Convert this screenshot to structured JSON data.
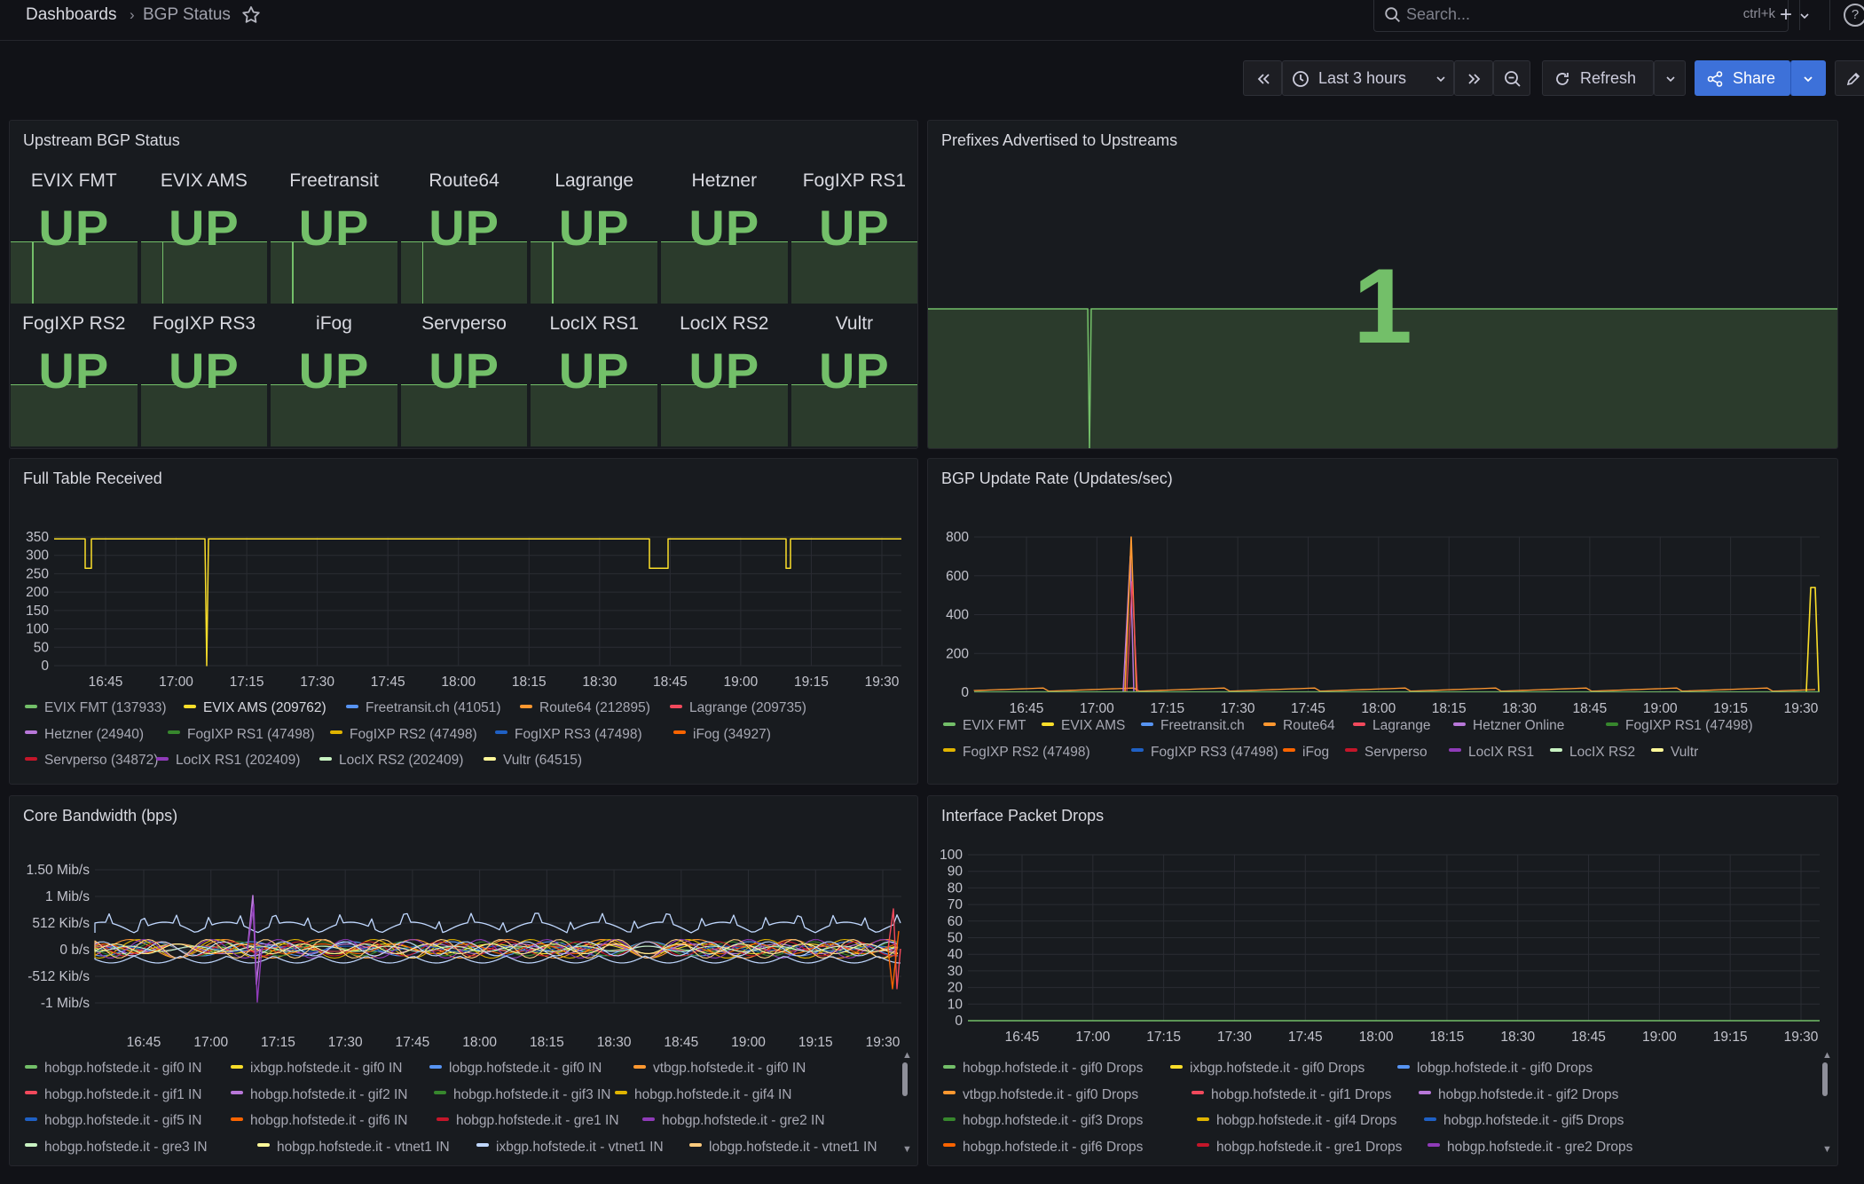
{
  "breadcrumb": {
    "root": "Dashboards",
    "separator": "›",
    "page": "BGP Status"
  },
  "search": {
    "placeholder": "Search...",
    "shortcut": "ctrl+k"
  },
  "topbar": {
    "plus": "+",
    "help": "?"
  },
  "toolbar": {
    "time_range": "Last 3 hours",
    "refresh": "Refresh",
    "share": "Share"
  },
  "colors": {
    "green": "#73bf69",
    "panel_bg": "#181b1f",
    "accent": "#3d71d9"
  },
  "icons": [
    "star-icon",
    "search-icon",
    "clock-icon",
    "zoom-out-icon",
    "refresh-icon",
    "share-icon",
    "edit-icon",
    "chevron-down-icon",
    "double-left-icon",
    "double-right-icon"
  ],
  "panels": {
    "upstream": {
      "title": "Upstream BGP Status",
      "items": [
        {
          "name": "EVIX FMT",
          "value": "UP"
        },
        {
          "name": "EVIX AMS",
          "value": "UP"
        },
        {
          "name": "Freetransit",
          "value": "UP"
        },
        {
          "name": "Route64",
          "value": "UP"
        },
        {
          "name": "Lagrange",
          "value": "UP"
        },
        {
          "name": "Hetzner",
          "value": "UP"
        },
        {
          "name": "FogIXP RS1",
          "value": "UP"
        },
        {
          "name": "FogIXP RS2",
          "value": "UP"
        },
        {
          "name": "FogIXP RS3",
          "value": "UP"
        },
        {
          "name": "iFog",
          "value": "UP"
        },
        {
          "name": "Servperso",
          "value": "UP"
        },
        {
          "name": "LocIX RS1",
          "value": "UP"
        },
        {
          "name": "LocIX RS2",
          "value": "UP"
        },
        {
          "name": "Vultr",
          "value": "UP"
        }
      ]
    },
    "prefixes": {
      "title": "Prefixes Advertised to Upstreams",
      "value": "1"
    },
    "fulltable": {
      "title": "Full Table Received",
      "legend": [
        "EVIX FMT (137933)",
        "EVIX AMS (209762)",
        "Freetransit.ch (41051)",
        "Route64 (212895)",
        "Lagrange (209735)",
        "Hetzner (24940)",
        "FogIXP RS1 (47498)",
        "FogIXP RS2 (47498)",
        "FogIXP RS3 (47498)",
        "iFog (34927)",
        "Servperso (34872)",
        "LocIX RS1 (202409)",
        "LocIX RS2 (202409)",
        "Vultr (64515)"
      ]
    },
    "updaterate": {
      "title": "BGP Update Rate (Updates/sec)",
      "legend": [
        "EVIX FMT",
        "EVIX AMS",
        "Freetransit.ch",
        "Route64",
        "Lagrange",
        "Hetzner Online",
        "FogIXP RS1 (47498)",
        "FogIXP RS2 (47498)",
        "FogIXP RS3 (47498)",
        "iFog",
        "Servperso",
        "LocIX RS1",
        "LocIX RS2",
        "Vultr"
      ]
    },
    "bandwidth": {
      "title": "Core Bandwidth (bps)",
      "legend": [
        "hobgp.hofstede.it - gif0 IN",
        "ixbgp.hofstede.it - gif0 IN",
        "lobgp.hofstede.it - gif0 IN",
        "vtbgp.hofstede.it - gif0 IN",
        "hobgp.hofstede.it - gif1 IN",
        "hobgp.hofstede.it - gif2 IN",
        "hobgp.hofstede.it - gif3 IN",
        "hobgp.hofstede.it - gif4 IN",
        "hobgp.hofstede.it - gif5 IN",
        "hobgp.hofstede.it - gif6 IN",
        "hobgp.hofstede.it - gre1 IN",
        "hobgp.hofstede.it - gre2 IN",
        "hobgp.hofstede.it - gre3 IN",
        "hobgp.hofstede.it - vtnet1 IN",
        "ixbgp.hofstede.it - vtnet1 IN",
        "lobgp.hofstede.it - vtnet1 IN"
      ]
    },
    "drops": {
      "title": "Interface Packet Drops",
      "legend": [
        "hobgp.hofstede.it - gif0 Drops",
        "ixbgp.hofstede.it - gif0 Drops",
        "lobgp.hofstede.it - gif0 Drops",
        "vtbgp.hofstede.it - gif0 Drops",
        "hobgp.hofstede.it - gif1 Drops",
        "hobgp.hofstede.it - gif2 Drops",
        "hobgp.hofstede.it - gif3 Drops",
        "hobgp.hofstede.it - gif4 Drops",
        "hobgp.hofstede.it - gif5 Drops",
        "hobgp.hofstede.it - gif6 Drops",
        "hobgp.hofstede.it - gre1 Drops",
        "hobgp.hofstede.it - gre2 Drops"
      ]
    }
  },
  "time_ticks": [
    "16:45",
    "17:00",
    "17:15",
    "17:30",
    "17:45",
    "18:00",
    "18:15",
    "18:30",
    "18:45",
    "19:00",
    "19:15",
    "19:30"
  ],
  "chart_data": [
    {
      "type": "line",
      "title": "Full Table Received",
      "x": [
        "16:45",
        "17:00",
        "17:15",
        "17:30",
        "17:45",
        "18:00",
        "18:15",
        "18:30",
        "18:45",
        "19:00",
        "19:15",
        "19:30"
      ],
      "ylim": [
        0,
        350
      ],
      "yticks": [
        "0",
        "50",
        "100",
        "150",
        "200",
        "250",
        "300",
        "350"
      ],
      "series": [
        {
          "name": "EVIX AMS (209762)",
          "values": [
            345,
            345,
            345,
            345,
            345,
            345,
            345,
            345,
            345,
            345,
            345,
            345
          ]
        }
      ]
    },
    {
      "type": "line",
      "title": "BGP Update Rate (Updates/sec)",
      "x": [
        "16:45",
        "17:00",
        "17:15",
        "17:30",
        "17:45",
        "18:00",
        "18:15",
        "18:30",
        "18:45",
        "19:00",
        "19:15",
        "19:30"
      ],
      "ylim": [
        0,
        800
      ],
      "yticks": [
        "0",
        "200",
        "400",
        "600",
        "800"
      ],
      "series": [
        {
          "name": "Route64",
          "values": [
            10,
            800,
            10,
            15,
            10,
            10,
            20,
            10,
            10,
            10,
            10,
            540
          ]
        }
      ]
    },
    {
      "type": "line",
      "title": "Core Bandwidth (bps)",
      "x": [
        "16:45",
        "17:00",
        "17:15",
        "17:30",
        "17:45",
        "18:00",
        "18:15",
        "18:30",
        "18:45",
        "19:00",
        "19:15",
        "19:30"
      ],
      "yticks": [
        "-1 Mib/s",
        "-512 Kib/s",
        "0 b/s",
        "512 Kib/s",
        "1 Mib/s",
        "1.50 Mib/s"
      ],
      "series": [
        {
          "name": "lobgp.hofstede.it - vtnet1 IN",
          "values": [
            300000,
            250000,
            350000,
            200000,
            250000,
            300000,
            250000,
            300000,
            400000,
            250000,
            200000,
            150000
          ]
        }
      ]
    },
    {
      "type": "line",
      "title": "Interface Packet Drops",
      "x": [
        "16:45",
        "17:00",
        "17:15",
        "17:30",
        "17:45",
        "18:00",
        "18:15",
        "18:30",
        "18:45",
        "19:00",
        "19:15",
        "19:30"
      ],
      "ylim": [
        0,
        100
      ],
      "yticks": [
        "0",
        "10",
        "20",
        "30",
        "40",
        "50",
        "60",
        "70",
        "80",
        "90",
        "100"
      ],
      "series": [
        {
          "name": "hobgp.hofstede.it - gif0 Drops",
          "values": [
            0,
            0,
            0,
            0,
            0,
            0,
            0,
            0,
            0,
            0,
            0,
            0
          ]
        }
      ]
    }
  ]
}
